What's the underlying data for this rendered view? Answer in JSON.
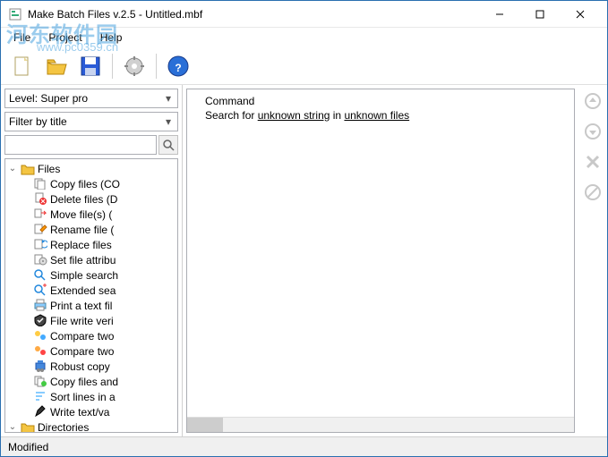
{
  "window": {
    "title": "Make Batch Files v.2.5 - Untitled.mbf"
  },
  "menu": {
    "file": "File",
    "project": "Project",
    "help": "Help"
  },
  "level": {
    "label": "Level: Super pro"
  },
  "filter": {
    "label": "Filter by title"
  },
  "tree": {
    "root1": "Files",
    "root2": "Directories",
    "items": [
      "Copy files (CO",
      "Delete files (D",
      "Move file(s) (",
      "Rename file (",
      "Replace files ",
      "Set file attribu",
      "Simple search",
      "Extended sea",
      "Print a text fil",
      "File write veri",
      "Compare two",
      "Compare two",
      "Robust copy ",
      "Copy files and",
      "Sort lines in a",
      "Write text/va"
    ]
  },
  "command": {
    "header": "Command",
    "prefix": "Search for ",
    "link1": "unknown string",
    "mid": " in ",
    "link2": "unknown files"
  },
  "status": {
    "text": "Modified"
  },
  "watermark": {
    "big": "河东软件园",
    "url": "www.pc0359.cn"
  }
}
